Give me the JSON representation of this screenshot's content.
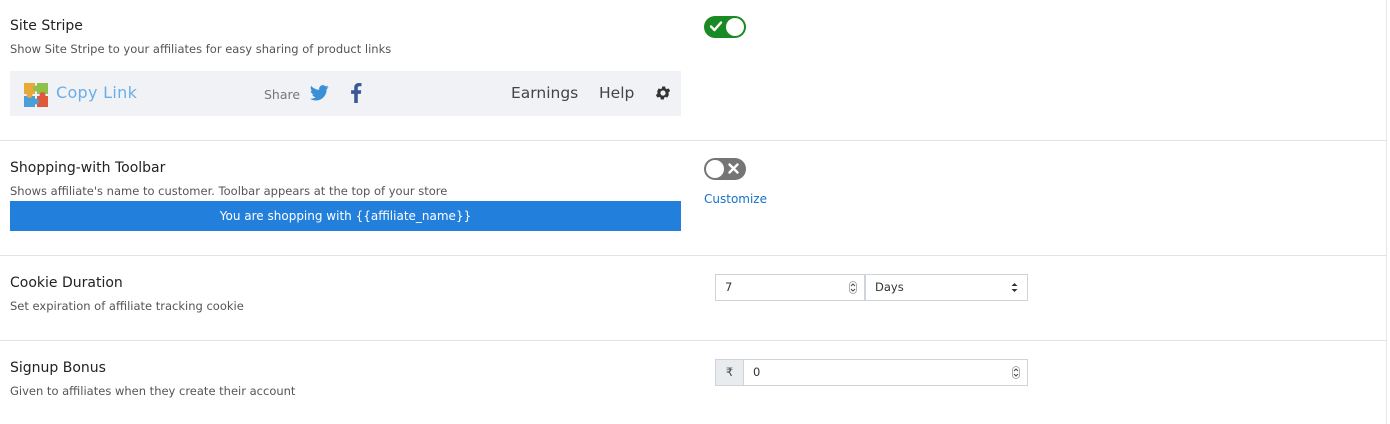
{
  "site_stripe": {
    "title": "Site Stripe",
    "description": "Show Site Stripe to your affiliates for easy sharing of product links",
    "enabled": true,
    "preview": {
      "copy_link": "Copy Link",
      "share": "Share",
      "earnings": "Earnings",
      "help": "Help"
    }
  },
  "shopping_toolbar": {
    "title": "Shopping-with Toolbar",
    "description": "Shows affiliate's name to customer. Toolbar appears at the top of your store",
    "enabled": false,
    "preview_text": "You are shopping with {{affiliate_name}}",
    "customize_label": "Customize"
  },
  "cookie_duration": {
    "title": "Cookie Duration",
    "description": "Set expiration of affiliate tracking cookie",
    "value": "7",
    "unit": "Days"
  },
  "signup_bonus": {
    "title": "Signup Bonus",
    "description": "Given to affiliates when they create their account",
    "currency_symbol": "₹",
    "value": "0"
  },
  "colors": {
    "toggle_on": "#1a8a24",
    "toggle_off": "#757575",
    "toolbar_bar": "#237fdc",
    "link": "#1572cc",
    "copy_link": "#6aaee8"
  },
  "icons": [
    "check-icon",
    "close-icon",
    "puzzle-logo-icon",
    "twitter-icon",
    "facebook-icon",
    "gear-icon",
    "spinner-arrows-icon",
    "select-caret-icon"
  ]
}
